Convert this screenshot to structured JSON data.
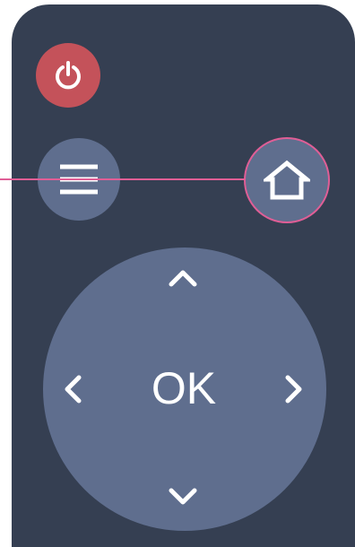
{
  "remote": {
    "ok_label": "OK",
    "buttons": {
      "power": {
        "icon": "power-icon",
        "color": "#c4525a"
      },
      "menu": {
        "icon": "menu-icon"
      },
      "home": {
        "icon": "home-icon",
        "highlight": "#e05e96"
      },
      "up": {
        "icon": "chevron-up-icon"
      },
      "down": {
        "icon": "chevron-down-icon"
      },
      "left": {
        "icon": "chevron-left-icon"
      },
      "right": {
        "icon": "chevron-right-icon"
      }
    },
    "colors": {
      "body": "#353f52",
      "button": "#5f6e8e",
      "icon": "#ffffff",
      "callout": "#e05e96"
    }
  }
}
